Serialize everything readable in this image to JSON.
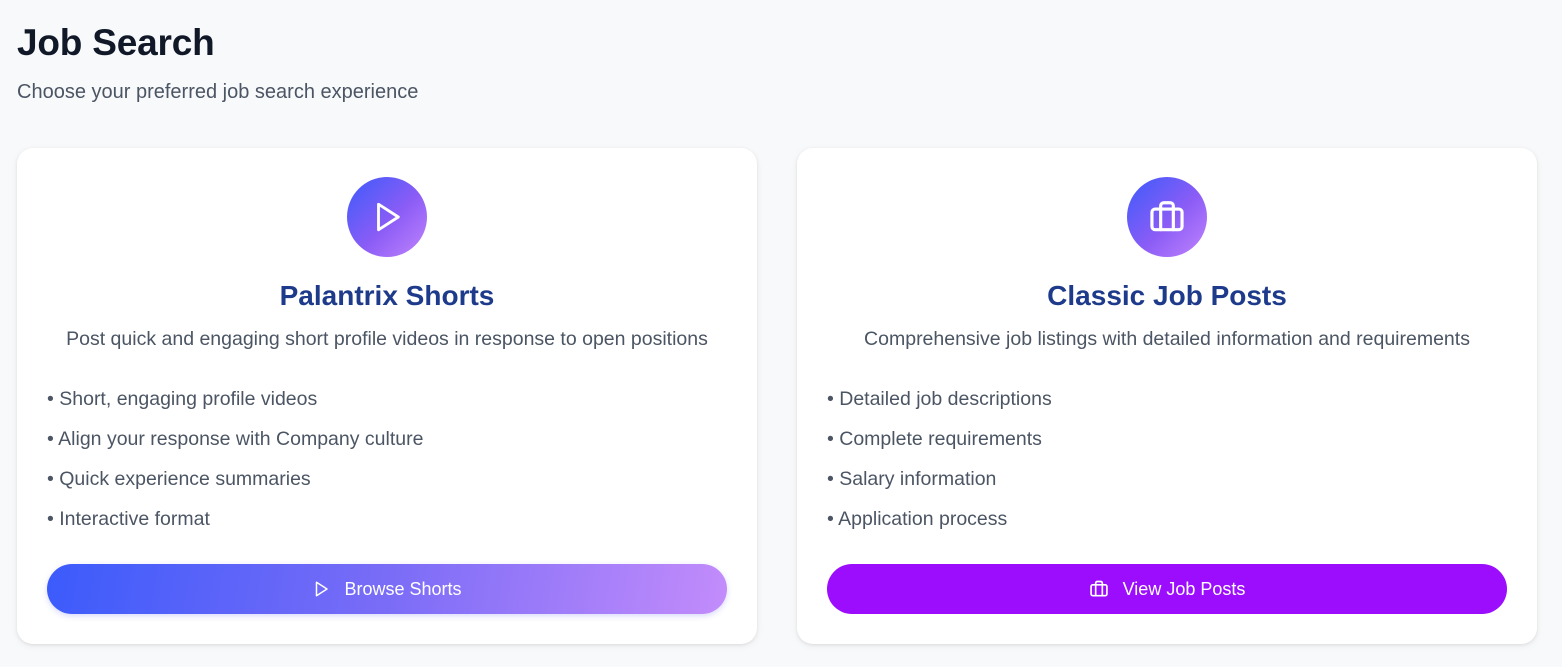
{
  "header": {
    "title": "Job Search",
    "subtitle": "Choose your preferred job search experience"
  },
  "cards": [
    {
      "icon": "play-icon",
      "title": "Palantrix Shorts",
      "description": "Post quick and engaging short profile videos in response to open positions",
      "features": [
        "• Short, engaging profile videos",
        "• Align your response with Company culture",
        "• Quick experience summaries",
        "• Interactive format"
      ],
      "button_label": "Browse Shorts",
      "button_icon": "play-icon"
    },
    {
      "icon": "briefcase-icon",
      "title": "Classic Job Posts",
      "description": "Comprehensive job listings with detailed information and requirements",
      "features": [
        "• Detailed job descriptions",
        "• Complete requirements",
        "• Salary information",
        "• Application process"
      ],
      "button_label": "View Job Posts",
      "button_icon": "briefcase-icon"
    }
  ],
  "colors": {
    "title": "#1e3a8a",
    "accent_gradient_start": "#3b5bfb",
    "accent_gradient_end": "#c084fc",
    "job_posts_button": "#9b0dfc"
  }
}
